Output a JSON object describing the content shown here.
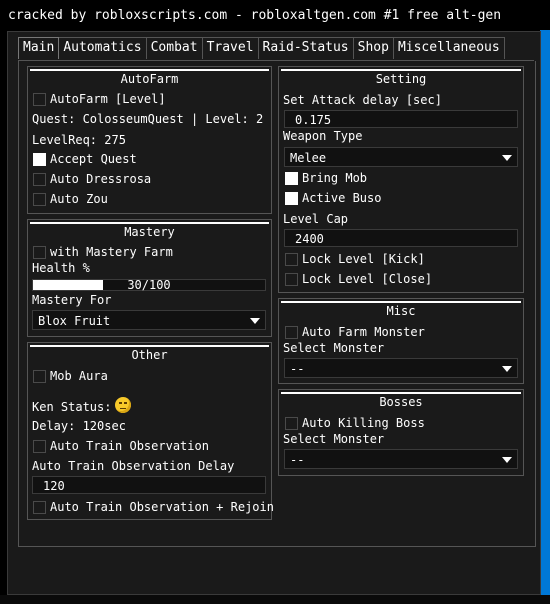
{
  "window_title": "cracked by robloxscripts.com - robloxaltgen.com #1 free alt-gen",
  "tabs": [
    "Main",
    "Automatics",
    "Combat",
    "Travel",
    "Raid-Status",
    "Shop",
    "Miscellaneous"
  ],
  "active_tab": "Main",
  "autofarm": {
    "title": "AutoFarm",
    "autofarm_level": {
      "label": "AutoFarm [Level]",
      "checked": false
    },
    "quest_text": "Quest: ColosseumQuest | Level: 2",
    "levelreq_text": "LevelReq: 275",
    "accept_quest": {
      "label": "Accept Quest",
      "checked": true
    },
    "auto_dressrosa": {
      "label": "Auto Dressrosa",
      "checked": false
    },
    "auto_zou": {
      "label": "Auto Zou",
      "checked": false
    }
  },
  "mastery": {
    "title": "Mastery",
    "with_mastery_farm": {
      "label": "with Mastery Farm",
      "checked": false
    },
    "health_label": "Health %",
    "health_value": 30,
    "health_max": 100,
    "health_text": "30/100",
    "mastery_for_label": "Mastery For",
    "mastery_for_value": "Blox Fruit"
  },
  "other": {
    "title": "Other",
    "mob_aura": {
      "label": "Mob Aura",
      "checked": false
    },
    "ken_status_label": "Ken Status:",
    "ken_status_icon": "smiley-face-icon",
    "delay_text": "Delay: 120sec",
    "auto_train_observation": {
      "label": "Auto Train Observation",
      "checked": false
    },
    "delay_field_label": "Auto Train Observation Delay",
    "delay_field_value": "120",
    "auto_train_rejoin": {
      "label": "Auto Train Observation + Rejoin",
      "checked": false
    }
  },
  "setting": {
    "title": "Setting",
    "attack_delay_label": "Set Attack delay [sec]",
    "attack_delay_value": "0.175",
    "weapon_type_label": "Weapon Type",
    "weapon_type_value": "Melee",
    "bring_mob": {
      "label": "Bring Mob",
      "checked": true
    },
    "active_buso": {
      "label": "Active Buso",
      "checked": true
    },
    "level_cap_label": "Level Cap",
    "level_cap_value": "2400",
    "lock_level_kick": {
      "label": "Lock Level [Kick]",
      "checked": false
    },
    "lock_level_close": {
      "label": "Lock Level [Close]",
      "checked": false
    }
  },
  "misc": {
    "title": "Misc",
    "auto_farm_monster": {
      "label": "Auto Farm Monster",
      "checked": false
    },
    "select_monster_label": "Select Monster",
    "select_monster_value": "--"
  },
  "bosses": {
    "title": "Bosses",
    "auto_killing_boss": {
      "label": "Auto Killing Boss",
      "checked": false
    },
    "select_monster_label": "Select Monster",
    "select_monster_value": "--"
  }
}
